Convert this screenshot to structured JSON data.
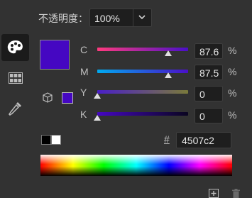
{
  "opacity": {
    "label": "不透明度：",
    "value": "100%"
  },
  "tools": [
    {
      "name": "color-wheel",
      "selected": true
    },
    {
      "name": "swatches",
      "selected": false
    },
    {
      "name": "eyedropper",
      "selected": false
    }
  ],
  "color": {
    "hex_color": "#4507c2",
    "hash": "#",
    "hex_value": "4507c2"
  },
  "channels": [
    {
      "label": "C",
      "value": "87.6",
      "percent": "%",
      "level": 87.6
    },
    {
      "label": "M",
      "value": "87.5",
      "percent": "%",
      "level": 87.5
    },
    {
      "label": "Y",
      "value": "0",
      "percent": "%",
      "level": 0
    },
    {
      "label": "K",
      "value": "0",
      "percent": "%",
      "level": 0
    }
  ],
  "colors": {
    "cyan_track_start": "#2b1f6e",
    "accent": "#4507c2"
  }
}
